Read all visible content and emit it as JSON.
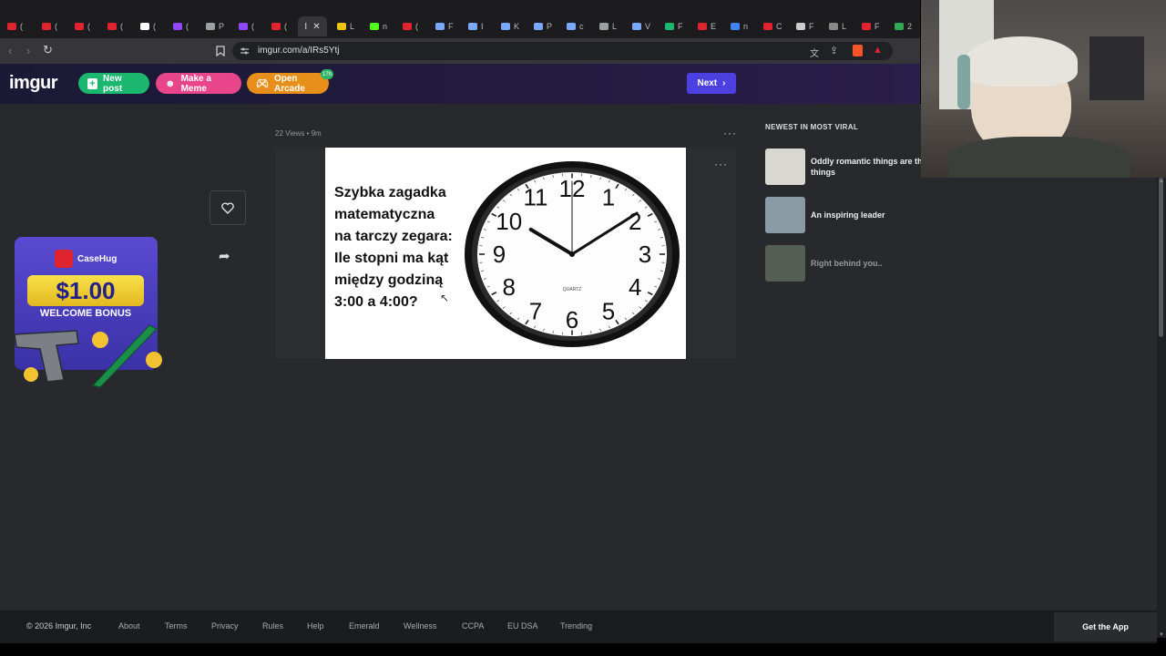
{
  "browser": {
    "url": "imgur.com/a/IRs5Ytj",
    "active_tab_label": "I",
    "tabs": [
      {
        "label": "(",
        "color": "#e0242f"
      },
      {
        "label": "(",
        "color": "#e0242f"
      },
      {
        "label": "(",
        "color": "#e0242f"
      },
      {
        "label": "(",
        "color": "#e0242f"
      },
      {
        "label": "(",
        "color": "#ffffff"
      },
      {
        "label": "(",
        "color": "#9146ff"
      },
      {
        "label": "P",
        "color": "#9aa0a6"
      },
      {
        "label": "(",
        "color": "#9146ff"
      },
      {
        "label": "(",
        "color": "#e0242f"
      },
      {
        "label": "L",
        "color": "#f1c40f"
      },
      {
        "label": "n",
        "color": "#53fc18"
      },
      {
        "label": "(",
        "color": "#e0242f"
      },
      {
        "label": "F",
        "color": "#7aa7ff"
      },
      {
        "label": "I",
        "color": "#7aa7ff"
      },
      {
        "label": "K",
        "color": "#7aa7ff"
      },
      {
        "label": "P",
        "color": "#7aa7ff"
      },
      {
        "label": "c",
        "color": "#7aa7ff"
      },
      {
        "label": "L",
        "color": "#9aa0a6"
      },
      {
        "label": "V",
        "color": "#7aa7ff"
      },
      {
        "label": "F",
        "color": "#1bb76e"
      },
      {
        "label": "E",
        "color": "#e0242f"
      },
      {
        "label": "n",
        "color": "#4285f4"
      },
      {
        "label": "C",
        "color": "#e0242f"
      },
      {
        "label": "F",
        "color": "#cccccc"
      },
      {
        "label": "L",
        "color": "#888888"
      },
      {
        "label": "F",
        "color": "#e0242f"
      },
      {
        "label": "2",
        "color": "#34a853"
      }
    ]
  },
  "header": {
    "logo": "imgur",
    "new_post": "New post",
    "make_meme": "Make a Meme",
    "open_arcade": "Open Arcade",
    "arcade_badge": "17h",
    "next": "Next"
  },
  "post": {
    "meta": "22 Views • 9m",
    "riddle_lines": [
      "Szybka zagadka",
      "matematyczna",
      "na tarczy zegara:",
      "Ile stopni ma kąt",
      "między godziną",
      "3:00 a 4:00?"
    ],
    "clock_brand": "QUARTZ",
    "clock_numbers": [
      "12",
      "1",
      "2",
      "3",
      "4",
      "5",
      "6",
      "7",
      "8",
      "9",
      "10",
      "11"
    ],
    "clock_time": "10:09"
  },
  "ad": {
    "brand": "CaseHug",
    "amount": "$1.00",
    "bonus": "WELCOME BONUS"
  },
  "sidebar": {
    "heading": "NEWEST IN MOST VIRAL",
    "items": [
      {
        "title": "Oddly romantic things are the best things",
        "thumb": "#d8d8d0"
      },
      {
        "title": "An inspiring leader",
        "thumb": "#8a9aa5"
      },
      {
        "title": "Right behind you..",
        "thumb": "#7a8a72"
      }
    ]
  },
  "footer": {
    "copyright": "© 2026 Imgur, Inc",
    "links": [
      "About",
      "Terms",
      "Privacy",
      "Rules",
      "Help",
      "Emerald",
      "Wellness",
      "CCPA",
      "EU DSA",
      "Trending"
    ],
    "get_app": "Get the App"
  },
  "colors": {
    "brand_green": "#1bb76e",
    "meme_pink": "#e8458b",
    "arcade_orange": "#e88f1a",
    "next_purple": "#4c41e0"
  }
}
